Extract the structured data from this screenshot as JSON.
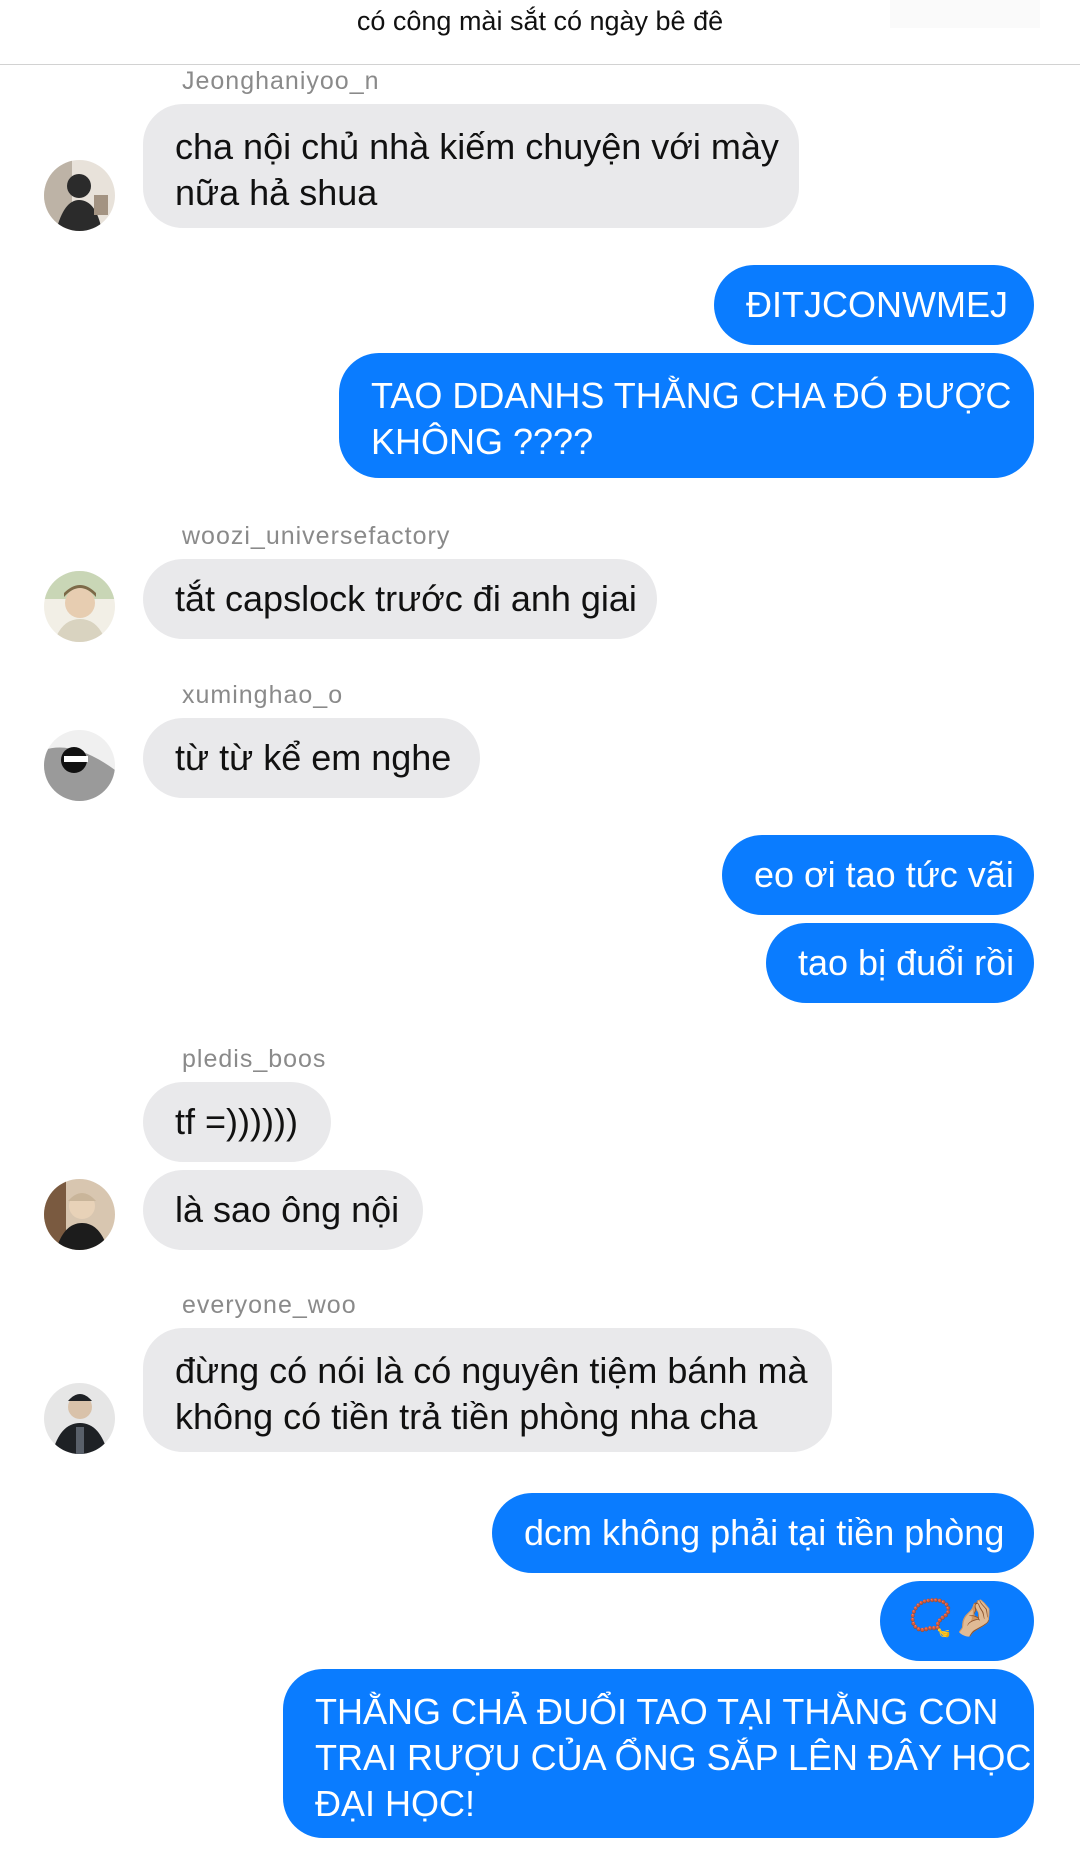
{
  "header": {
    "title": "có công mài sắt có ngày bê đê"
  },
  "messages": [
    {
      "id": "m1",
      "type": "in",
      "username": "Jeonghaniyoo_n",
      "text": "cha nội chủ nhà kiếm chuyện với mày nữa hả shua"
    },
    {
      "id": "m2",
      "type": "out",
      "text": "ĐITJCONWMEJ"
    },
    {
      "id": "m3",
      "type": "out",
      "text": "TAO DDANHS THẰNG CHA ĐÓ ĐƯỢC KHÔNG ????"
    },
    {
      "id": "m4",
      "type": "in",
      "username": "woozi_universefactory",
      "text": "tắt capslock trước đi anh giai"
    },
    {
      "id": "m5",
      "type": "in",
      "username": "xuminghao_o",
      "text": "từ từ kể em nghe"
    },
    {
      "id": "m6",
      "type": "out",
      "text": "eo ơi tao tức vãi"
    },
    {
      "id": "m7",
      "type": "out",
      "text": "tao bị đuổi rồi"
    },
    {
      "id": "m8",
      "type": "in",
      "username": "pledis_boos",
      "text": "tf =))))))"
    },
    {
      "id": "m9",
      "type": "in",
      "text": "là sao ông nội"
    },
    {
      "id": "m10",
      "type": "in",
      "username": "everyone_woo",
      "text": "đừng có nói là có nguyên tiệm bánh mà không có tiền trả tiền phòng nha cha"
    },
    {
      "id": "m11",
      "type": "out",
      "text": "dcm không phải tại tiền phòng"
    },
    {
      "id": "m12",
      "type": "out",
      "text": "📿🤌🏼"
    },
    {
      "id": "m13",
      "type": "out",
      "text": "THẰNG CHẢ ĐUỔI TAO TẠI THẰNG CON TRAI RƯỢU CỦA ỔNG SẮP LÊN ĐÂY HỌC ĐẠI HỌC!"
    }
  ],
  "lines": {
    "m1": [
      "cha nội chủ nhà kiếm chuyện với mày",
      "nữa hả shua"
    ],
    "m3": [
      "TAO DDANHS THẰNG CHA ĐÓ ĐƯỢC",
      "KHÔNG ????"
    ],
    "m10": [
      "đừng có nói là có nguyên tiệm bánh mà",
      "không có tiền trả tiền phòng nha cha"
    ],
    "m13": [
      "THẰNG CHẢ ĐUỔI TAO TẠI THẰNG CON",
      "TRAI RƯỢU CỦA ỔNG SẮP LÊN ĐÂY HỌC",
      "ĐẠI HỌC!"
    ]
  },
  "avatars": [
    {
      "id": "a1",
      "name": "avatar-jeonghaniyoo-n",
      "colors": [
        "#2b2b2b",
        "#a39382",
        "#e8e2da"
      ]
    },
    {
      "id": "a2",
      "name": "avatar-woozi-universefactory",
      "colors": [
        "#d9d3c0",
        "#7d6a48",
        "#f2efe6"
      ]
    },
    {
      "id": "a3",
      "name": "avatar-xuminghao-o",
      "colors": [
        "#111111",
        "#9a9a9a",
        "#f0f0f0"
      ]
    },
    {
      "id": "a4",
      "name": "avatar-pledis-boos",
      "colors": [
        "#1c1c1c",
        "#7a5a40",
        "#d8c6b0"
      ]
    },
    {
      "id": "a5",
      "name": "avatar-everyone-woo",
      "colors": [
        "#1e2125",
        "#59606a",
        "#e6e6e6"
      ]
    }
  ],
  "colors": {
    "outgoing": "#0a7cff",
    "incoming": "#e9e9eb",
    "username": "#8a8a8a"
  }
}
